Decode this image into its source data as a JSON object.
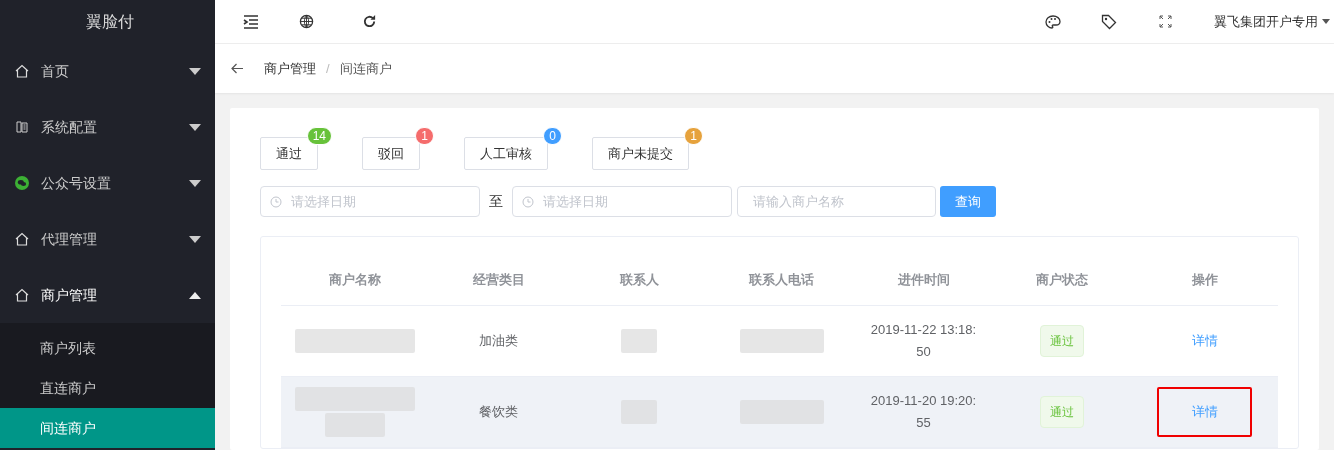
{
  "sidebar": {
    "logo": "翼脸付",
    "items": [
      {
        "label": "首页",
        "expanded": false
      },
      {
        "label": "系统配置",
        "expanded": false
      },
      {
        "label": "公众号设置",
        "expanded": false
      },
      {
        "label": "代理管理",
        "expanded": false
      },
      {
        "label": "商户管理",
        "expanded": true,
        "children": [
          {
            "label": "商户列表",
            "selected": false
          },
          {
            "label": "直连商户",
            "selected": false
          },
          {
            "label": "间连商户",
            "selected": true
          }
        ]
      }
    ]
  },
  "header": {
    "user": "翼飞集团开户专用"
  },
  "breadcrumb": [
    "商户管理",
    "间连商户"
  ],
  "breadcrumb_separator": "/",
  "status_tabs": [
    {
      "label": "通过",
      "count": "14",
      "color": "#67c23a"
    },
    {
      "label": "驳回",
      "count": "1",
      "color": "#f56c6c"
    },
    {
      "label": "人工审核",
      "count": "0",
      "color": "#409eff"
    },
    {
      "label": "商户未提交",
      "count": "1",
      "color": "#e6a23c"
    }
  ],
  "filters": {
    "start_date": {
      "placeholder": "请选择日期"
    },
    "range_separator": "至",
    "end_date": {
      "placeholder": "请选择日期"
    },
    "name": {
      "placeholder": "请输入商户名称"
    },
    "search_button": "查询"
  },
  "table": {
    "columns": [
      "商户名称",
      "经营类目",
      "联系人",
      "联系人电话",
      "进件时间",
      "商户状态",
      "操作"
    ],
    "rows": [
      {
        "highlighted": false,
        "cells": [
          {
            "kind": "blurred"
          },
          {
            "kind": "text",
            "text": "加油类"
          },
          {
            "kind": "blurred"
          },
          {
            "kind": "blurred"
          },
          {
            "kind": "text",
            "text": "2019-11-22 13:18:\n50"
          },
          {
            "kind": "tag",
            "text": "通过"
          },
          {
            "kind": "link",
            "text": "详情",
            "annotated": false
          }
        ]
      },
      {
        "highlighted": true,
        "cells": [
          {
            "kind": "blurred_tall"
          },
          {
            "kind": "text",
            "text": "餐饮类"
          },
          {
            "kind": "blurred"
          },
          {
            "kind": "blurred"
          },
          {
            "kind": "text",
            "text": "2019-11-20 19:20:\n55"
          },
          {
            "kind": "tag",
            "text": "通过"
          },
          {
            "kind": "link",
            "text": "详情",
            "annotated": true
          }
        ]
      }
    ]
  }
}
